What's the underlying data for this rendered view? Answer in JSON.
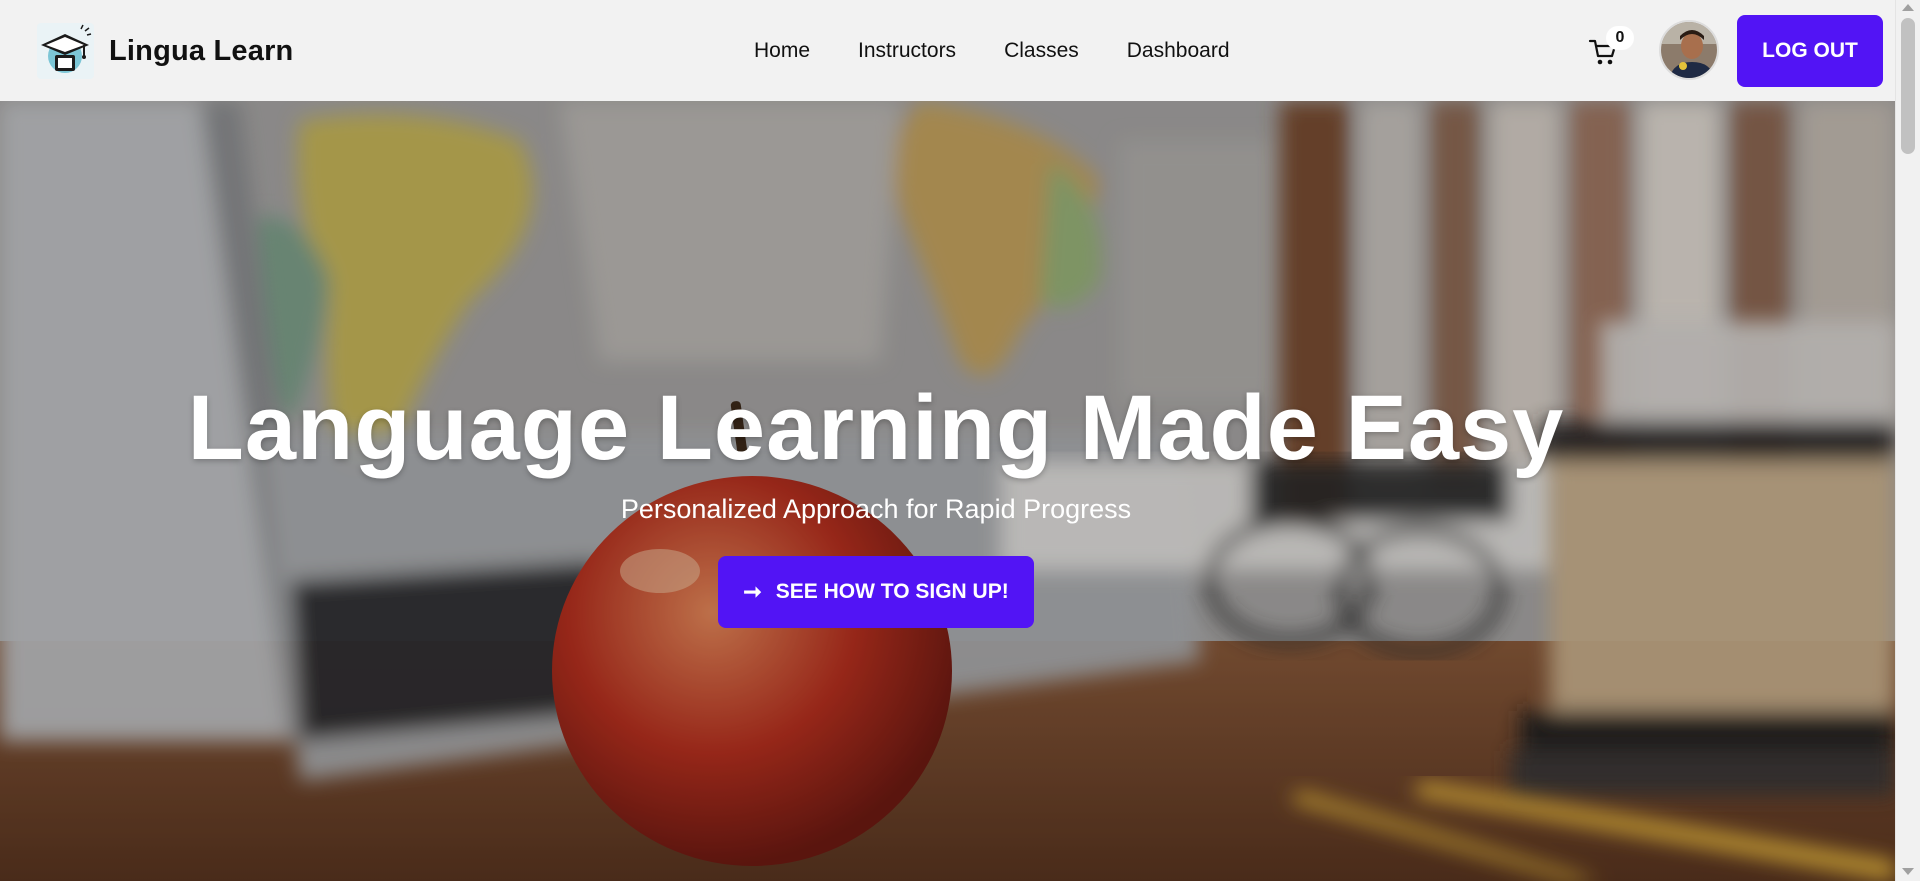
{
  "brand": {
    "name": "Lingua Learn",
    "logo_icon": "graduation-cap-icon"
  },
  "nav": {
    "items": [
      {
        "label": "Home"
      },
      {
        "label": "Instructors"
      },
      {
        "label": "Classes"
      },
      {
        "label": "Dashboard"
      }
    ]
  },
  "cart": {
    "icon": "cart-icon",
    "count": "0"
  },
  "user": {
    "avatar_icon": "user-avatar"
  },
  "logout": {
    "label": "LOG OUT"
  },
  "hero": {
    "title": "Language Learning Made Easy",
    "subtitle": "Personalized Approach for Rapid Progress",
    "cta_label": "SEE HOW TO SIGN UP!",
    "cta_icon": "arrow-right-icon"
  },
  "colors": {
    "accent": "#5214f5",
    "navbar_bg": "#f2f2f2",
    "text_dark": "#111111",
    "text_light": "#ffffff"
  }
}
